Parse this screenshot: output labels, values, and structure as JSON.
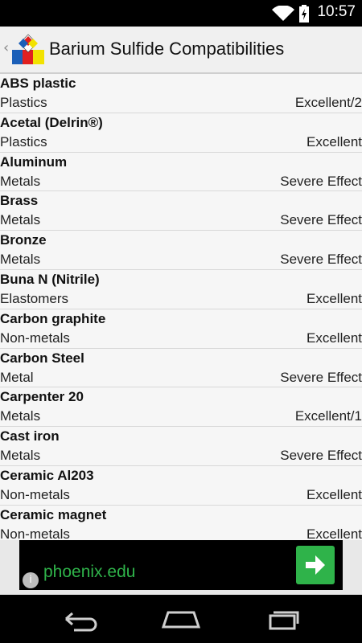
{
  "status_bar": {
    "time": "10:57"
  },
  "action_bar": {
    "title": "Barium Sulfide Compatibilities"
  },
  "rows": [
    {
      "name": "ABS plastic",
      "category": "Plastics",
      "rating": "Excellent/2"
    },
    {
      "name": "Acetal (Delrin®)",
      "category": "Plastics",
      "rating": "Excellent"
    },
    {
      "name": "Aluminum",
      "category": "Metals",
      "rating": "Severe Effect"
    },
    {
      "name": "Brass",
      "category": "Metals",
      "rating": "Severe Effect"
    },
    {
      "name": "Bronze",
      "category": "Metals",
      "rating": "Severe Effect"
    },
    {
      "name": "Buna N (Nitrile)",
      "category": "Elastomers",
      "rating": "Excellent"
    },
    {
      "name": "Carbon graphite",
      "category": "Non-metals",
      "rating": "Excellent"
    },
    {
      "name": "Carbon Steel",
      "category": "Metal",
      "rating": "Severe Effect"
    },
    {
      "name": "Carpenter 20",
      "category": "Metals",
      "rating": "Excellent/1"
    },
    {
      "name": "Cast iron",
      "category": "Metals",
      "rating": "Severe Effect"
    },
    {
      "name": "Ceramic Al203",
      "category": "Non-metals",
      "rating": "Excellent"
    },
    {
      "name": "Ceramic magnet",
      "category": "Non-metals",
      "rating": "Excellent"
    }
  ],
  "ad": {
    "url": "phoenix.edu",
    "info": "i"
  },
  "icons": {
    "wifi": "wifi-icon",
    "battery": "battery-charging-icon",
    "back": "back-chevron-icon",
    "app": "hazard-diamond-app-icon",
    "ad_go": "arrow-right-icon",
    "nav_back": "nav-back-icon",
    "nav_home": "nav-home-icon",
    "nav_recents": "nav-recents-icon"
  },
  "colors": {
    "accent_green": "#2fb34a",
    "status_bar": "#000000",
    "action_bar": "#f0f0f0"
  }
}
